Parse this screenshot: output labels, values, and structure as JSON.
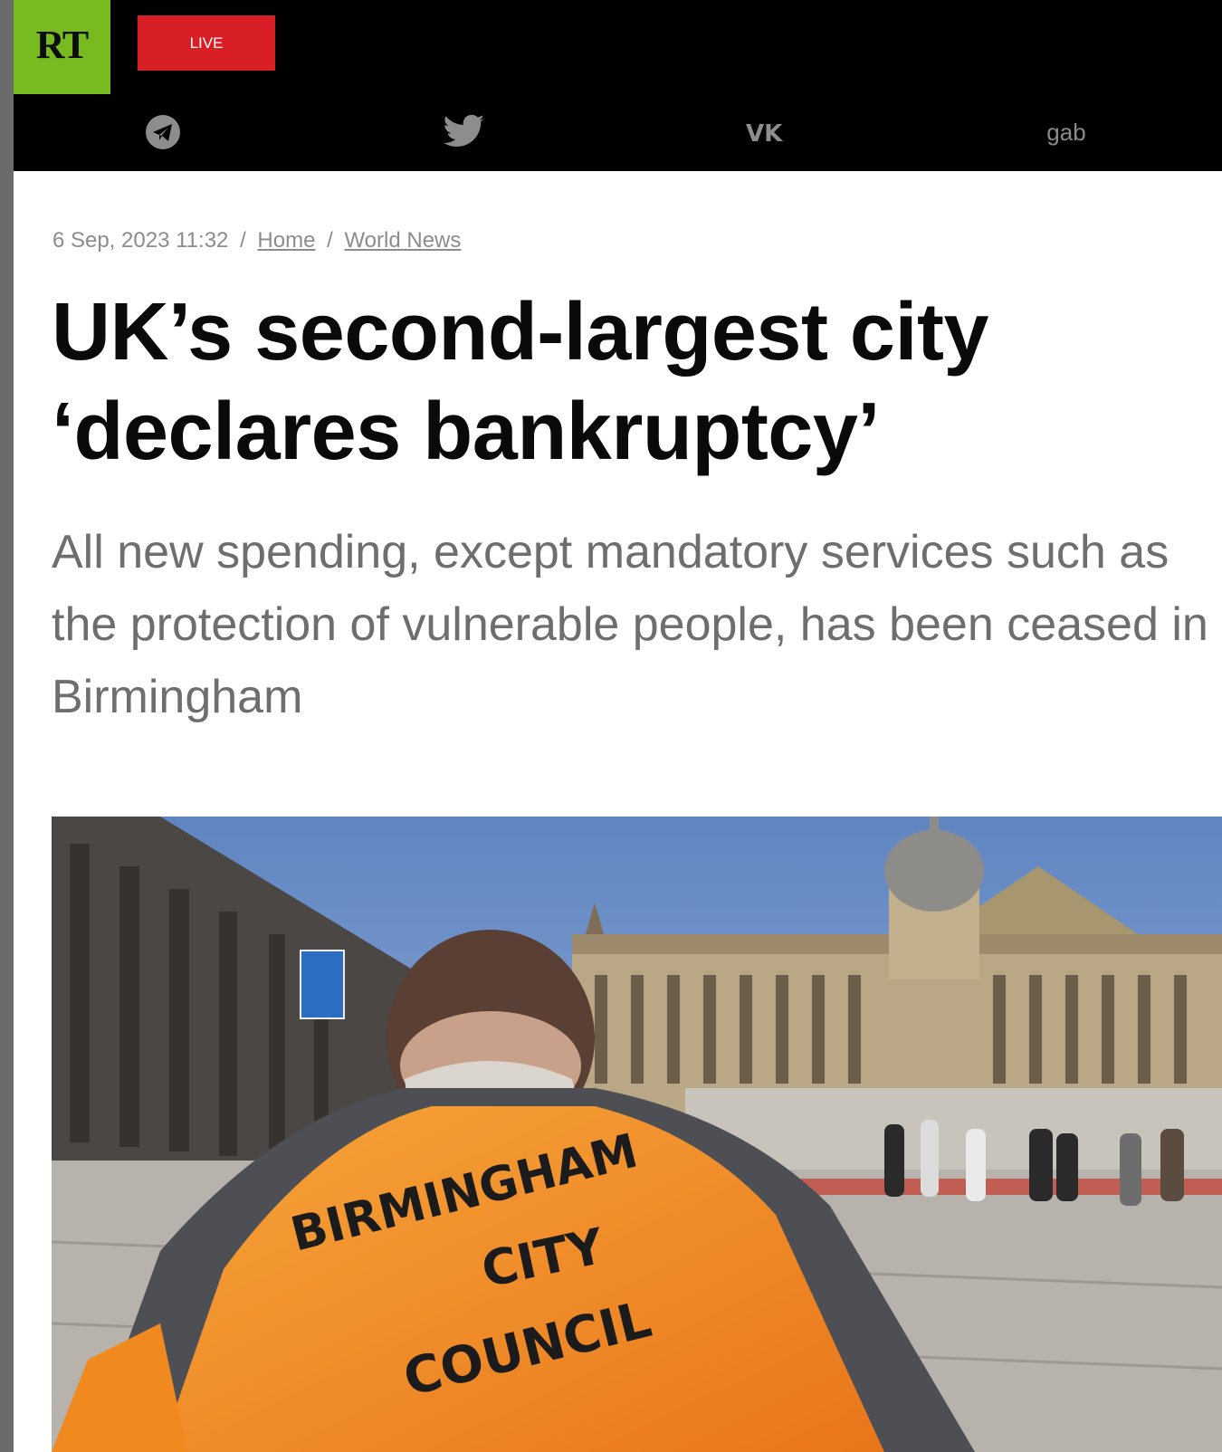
{
  "header": {
    "logo_text": "RT",
    "live_label": "LIVE",
    "social": [
      {
        "name": "telegram",
        "icon": "telegram-icon"
      },
      {
        "name": "twitter",
        "icon": "twitter-bird-icon"
      },
      {
        "name": "vk",
        "icon": "vk-icon",
        "label": "VK"
      },
      {
        "name": "gab",
        "icon": "gab-icon",
        "label": "gab"
      }
    ]
  },
  "article": {
    "date": "6 Sep, 2023 11:32",
    "separator": "/",
    "breadcrumbs": [
      "Home",
      "World News"
    ],
    "headline": "UK’s second-largest city ‘declares bankruptcy’",
    "subheadline": "All new spending, except mandatory services such as the protection of vulnerable people, has been ceased in Birmingham",
    "image": {
      "vest_lines": [
        "BIRMINGHAM",
        "CITY",
        "COUNCIL"
      ]
    }
  },
  "colors": {
    "brand_green": "#77bb21",
    "live_red": "#d81f26",
    "topbar": "#000000",
    "vest_orange": "#f08a1e"
  }
}
